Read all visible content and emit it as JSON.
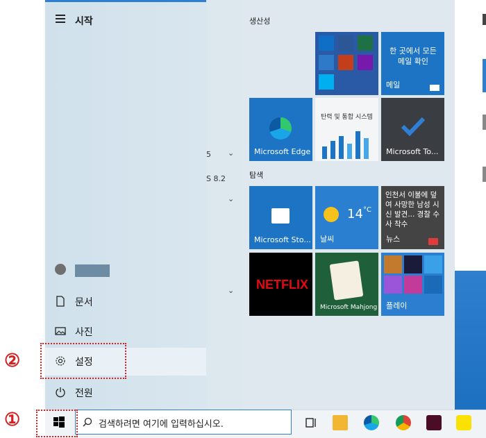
{
  "start_menu": {
    "title": "시작",
    "nav": {
      "documents": "문서",
      "pictures": "사진",
      "settings": "설정",
      "power": "전원"
    },
    "list_fragments": [
      "5",
      "S 8.2"
    ]
  },
  "tiles": {
    "group_productivity": "생산성",
    "group_explore": "탐색",
    "mail_headline": "한 곳에서 모든 메일 확인",
    "mail_label": "메일",
    "edge_label": "Microsoft Edge",
    "news_image_text": "탄력 및 통합 시스템",
    "todo_label": "Microsoft To...",
    "store_label": "Microsoft Sto...",
    "weather_temp": "14",
    "weather_unit": "°C",
    "weather_label": "날씨",
    "news_headline": "인천서 이불에 덮여 사망한 남성 시신 발견... 경찰 수사 착수",
    "news_label": "뉴스",
    "netflix_text": "NETFLIX",
    "mahjong_label": "Microsoft Mahjong",
    "play_label": "플레이"
  },
  "taskbar": {
    "search_placeholder": "검색하려면 여기에 입력하십시오."
  },
  "annotations": {
    "step1": "①",
    "step2": "②"
  },
  "colors": {
    "accent": "#2c7fd1",
    "tile_blue": "#1e74c4",
    "annotation_red": "#d42020"
  }
}
